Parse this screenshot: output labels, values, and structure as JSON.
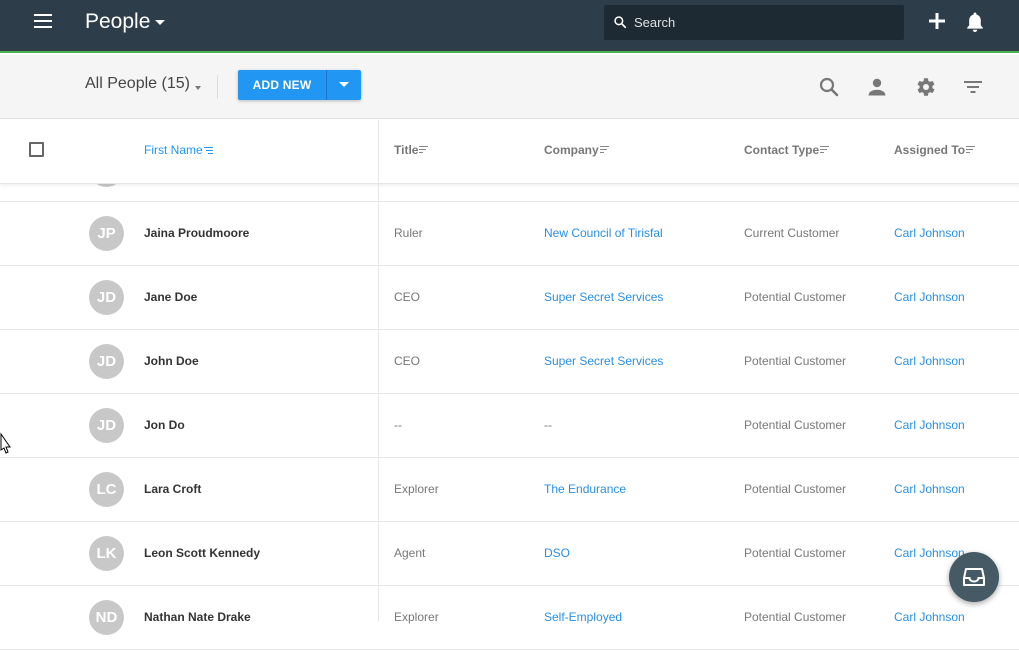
{
  "topbar": {
    "title": "People",
    "search_placeholder": "Search",
    "bg_color": "#2d3e4a",
    "icons": [
      "hamburger-menu-icon",
      "search-icon",
      "plus-icon",
      "bell-icon"
    ]
  },
  "toolbar": {
    "view_label": "All People (15)",
    "add_new_label": "ADD NEW",
    "accent_color": "#2196f3",
    "icons": [
      "search-icon",
      "person-icon",
      "gear-icon",
      "filter-icon"
    ]
  },
  "table": {
    "columns": [
      {
        "label": "First Name",
        "sorted": true
      },
      {
        "label": "Title"
      },
      {
        "label": "Company"
      },
      {
        "label": "Contact Type"
      },
      {
        "label": "Assigned To"
      }
    ],
    "rows": [
      {
        "initials": "JP",
        "name": "Jaina Proudmoore",
        "title": "Ruler",
        "company": "New Council of Tirisfal",
        "contact_type": "Current Customer",
        "assigned_to": "Carl Johnson"
      },
      {
        "initials": "JD",
        "name": "Jane Doe",
        "title": "CEO",
        "company": "Super Secret Services",
        "contact_type": "Potential Customer",
        "assigned_to": "Carl Johnson"
      },
      {
        "initials": "JD",
        "name": "John Doe",
        "title": "CEO",
        "company": "Super Secret Services",
        "contact_type": "Potential Customer",
        "assigned_to": "Carl Johnson"
      },
      {
        "initials": "JD",
        "name": "Jon Do",
        "title": "--",
        "company": "--",
        "contact_type": "Potential Customer",
        "assigned_to": "Carl Johnson"
      },
      {
        "initials": "LC",
        "name": "Lara Croft",
        "title": "Explorer",
        "company": "The Endurance",
        "contact_type": "Potential Customer",
        "assigned_to": "Carl Johnson"
      },
      {
        "initials": "LK",
        "name": "Leon Scott Kennedy",
        "title": "Agent",
        "company": "DSO",
        "contact_type": "Potential Customer",
        "assigned_to": "Carl Johnson"
      },
      {
        "initials": "ND",
        "name": "Nathan Nate Drake",
        "title": "Explorer",
        "company": "Self-Employed",
        "contact_type": "Potential Customer",
        "assigned_to": "Carl Johnson"
      }
    ]
  },
  "fab": {
    "icon": "inbox-icon"
  }
}
